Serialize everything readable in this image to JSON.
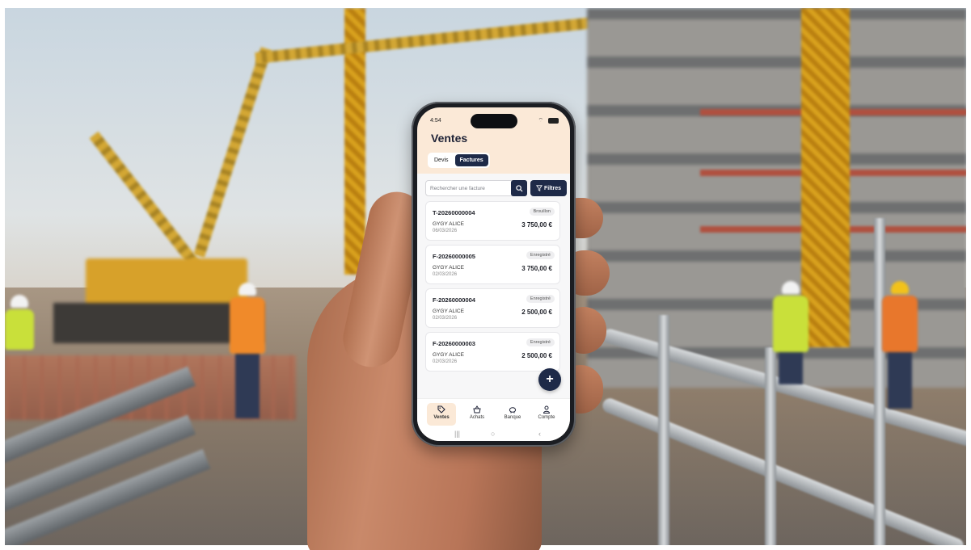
{
  "status_bar": {
    "time": "4:54"
  },
  "header": {
    "title": "Ventes"
  },
  "tabs": [
    {
      "label": "Devis",
      "active": false
    },
    {
      "label": "Factures",
      "active": true
    }
  ],
  "search": {
    "placeholder": "Rechercher une facture"
  },
  "filter": {
    "label": "Filtres"
  },
  "invoices": [
    {
      "number": "T-20260000004",
      "status": "Brouillon",
      "client": "GYGY ALICE",
      "date": "06/03/2026",
      "amount": "3 750,00 €"
    },
    {
      "number": "F-20260000005",
      "status": "Enregistré",
      "client": "GYGY ALICE",
      "date": "02/03/2026",
      "amount": "3 750,00 €"
    },
    {
      "number": "F-20260000004",
      "status": "Enregistré",
      "client": "GYGY ALICE",
      "date": "02/03/2026",
      "amount": "2 500,00 €"
    },
    {
      "number": "F-20260000003",
      "status": "Enregistré",
      "client": "GYGY ALICE",
      "date": "02/03/2026",
      "amount": "2 500,00 €"
    }
  ],
  "fab": {
    "icon": "plus-icon"
  },
  "bottom_nav": [
    {
      "label": "Ventes",
      "icon": "tag-icon",
      "active": true
    },
    {
      "label": "Achats",
      "icon": "basket-icon",
      "active": false
    },
    {
      "label": "Banque",
      "icon": "piggy-bank-icon",
      "active": false
    },
    {
      "label": "Compte",
      "icon": "user-icon",
      "active": false
    }
  ],
  "colors": {
    "accent": "#1e2a48",
    "header_bg": "#fbe9d7",
    "list_bg": "#f7f7f8"
  }
}
